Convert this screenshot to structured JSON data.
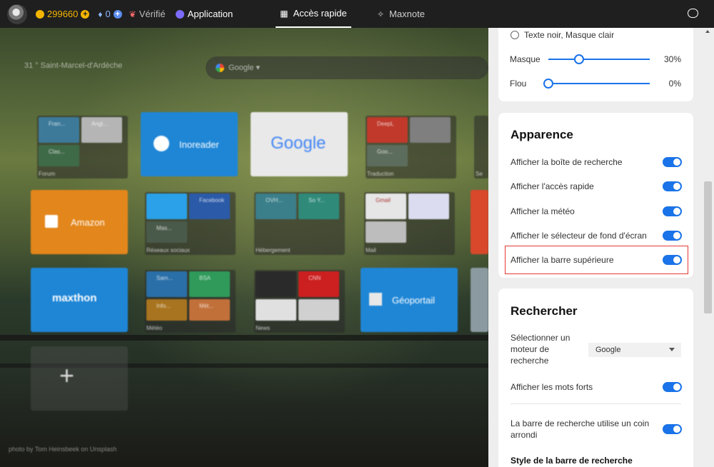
{
  "topbar": {
    "coins": "299660",
    "gems": "0",
    "verified": "Vérifié",
    "application": "Application",
    "tabs": [
      "Accès rapide",
      "Maxnote"
    ]
  },
  "background": {
    "weather": "31 ° Saint-Marcel-d'Ardèche",
    "search_engine": "Google ▾",
    "credit": "photo by Tom Heinsbeek on Unsplash"
  },
  "tiles": {
    "folder_forum": {
      "title": "Forum",
      "items": [
        "Fran...",
        "Angl...",
        "Clas..."
      ]
    },
    "inoreader": "Inoreader",
    "google": "Google",
    "folder_traduction": {
      "title": "Traduction",
      "items": [
        "DeepL",
        "",
        "Goo..."
      ]
    },
    "se": "Se",
    "amazon": "Amazon",
    "folder_social": {
      "title": "Réseaux sociaux",
      "items": [
        "",
        "Facebook",
        "Mas..."
      ]
    },
    "folder_hebergement": {
      "title": "Hébergement",
      "items": [
        "OVH...",
        "So Y..."
      ]
    },
    "folder_mail": {
      "title": "Mail",
      "items": [
        "Gmail",
        ""
      ]
    },
    "maxthon": "maxthon",
    "folder_meteo": {
      "title": "Météo",
      "items": [
        "Sam...",
        "BSA",
        "Info...",
        "Mét..."
      ]
    },
    "folder_news": {
      "title": "News",
      "items": [
        "",
        "CNN"
      ]
    },
    "geoportail": "Géoportail",
    "add": "+"
  },
  "panel": {
    "radio_label": "Texte noir, Masque clair",
    "sliders": [
      {
        "label": "Masque",
        "value": "30%",
        "percent": 30
      },
      {
        "label": "Flou",
        "value": "0%",
        "percent": 0
      }
    ],
    "appearance": {
      "title": "Apparence",
      "toggles": [
        "Afficher la boîte de recherche",
        "Afficher l'accès rapide",
        "Afficher la météo",
        "Afficher le sélecteur de fond d'écran",
        "Afficher la barre supérieure"
      ]
    },
    "search": {
      "title": "Rechercher",
      "select_label": "Sélectionner un moteur de recherche",
      "select_value": "Google",
      "show_trending": "Afficher les mots forts",
      "rounded": "La barre de recherche utilise un coin arrondi",
      "style_title": "Style de la barre de recherche"
    }
  },
  "colors": {
    "accent": "#1a73e8",
    "highlight": "#e53935",
    "topbar": "#1f1f1f",
    "coin": "#f4b400"
  }
}
